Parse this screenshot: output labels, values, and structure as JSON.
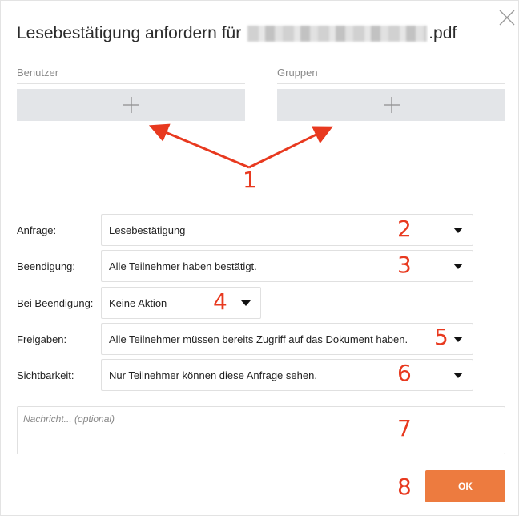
{
  "dialog": {
    "title_prefix": "Lesebestätigung anfordern für",
    "title_suffix": ".pdf",
    "close_icon": "close-icon"
  },
  "recipients": {
    "users_label": "Benutzer",
    "groups_label": "Gruppen",
    "add_icon": "plus-icon"
  },
  "form": {
    "request_label": "Anfrage:",
    "request_value": "Lesebestätigung",
    "completion_label": "Beendigung:",
    "completion_value": "Alle Teilnehmer haben bestätigt.",
    "on_completion_label": "Bei Beendigung:",
    "on_completion_value": "Keine Aktion",
    "shares_label": "Freigaben:",
    "shares_value": "Alle Teilnehmer müssen bereits Zugriff auf das Dokument haben.",
    "visibility_label": "Sichtbarkeit:",
    "visibility_value": "Nur Teilnehmer können diese Anfrage sehen.",
    "message_placeholder": "Nachricht... (optional)"
  },
  "actions": {
    "ok_label": "OK"
  },
  "annotations": {
    "n1": "1",
    "n2": "2",
    "n3": "3",
    "n4": "4",
    "n5": "5",
    "n6": "6",
    "n7": "7",
    "n8": "8"
  },
  "colors": {
    "annotation": "#e8391f",
    "ok_button": "#ed7b3f",
    "add_box": "#e3e5e8"
  }
}
